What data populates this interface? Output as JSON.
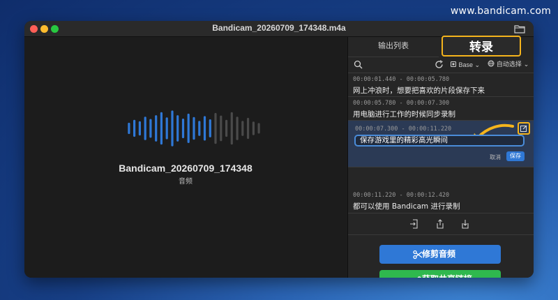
{
  "watermark": "www.bandicam.com",
  "window": {
    "title": "Bandicam_20260709_174348.m4a"
  },
  "player": {
    "file_name": "Bandicam_20260709_174348",
    "file_type": "音频"
  },
  "tabs": [
    {
      "label": "输出列表",
      "active": false
    },
    {
      "label": "转录",
      "active": true
    }
  ],
  "toolbar": {
    "model": "Base",
    "language": "自动选择"
  },
  "segments": [
    {
      "time": "00:00:01.440 - 00:00:05.780",
      "text": "网上冲浪时，想要把喜欢的片段保存下来"
    },
    {
      "time": "00:00:05.780 - 00:00:07.300",
      "text": "用电脑进行工作的时候同步录制"
    },
    {
      "time": "00:00:07.300 - 00:00:11.220",
      "text": "保存游戏里的精彩高光瞬间",
      "editing": true
    },
    {
      "time": "00:00:11.220 - 00:00:12.420",
      "text": "都可以使用 Bandicam 进行录制"
    }
  ],
  "edit": {
    "cancel_label": "取消",
    "save_label": "保存"
  },
  "buttons": {
    "trim": "修剪音频",
    "share": "获取共享链接"
  },
  "colors": {
    "accent_blue": "#2f78d6",
    "green": "#2fb84e",
    "highlight": "#f5b41c"
  },
  "icons": [
    "folder-icon",
    "search-icon",
    "refresh-icon",
    "chip-icon",
    "globe-icon",
    "edit-icon",
    "import-icon",
    "share-icon",
    "download-icon",
    "scissors-icon",
    "link-icon"
  ]
}
